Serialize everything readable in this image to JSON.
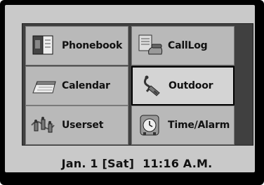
{
  "menu": {
    "items": [
      {
        "label": "Phonebook",
        "icon": "phonebook-icon",
        "selected": false
      },
      {
        "label": "CallLog",
        "icon": "call-log-icon",
        "selected": false
      },
      {
        "label": "Calendar",
        "icon": "calendar-icon",
        "selected": false
      },
      {
        "label": "Outdoor",
        "icon": "outdoor-icon",
        "selected": true
      },
      {
        "label": "Userset",
        "icon": "userset-icon",
        "selected": false
      },
      {
        "label": "Time/Alarm",
        "icon": "alarm-clock-icon",
        "selected": false
      }
    ]
  },
  "status": {
    "date": "Jan. 1 [Sat]",
    "time": "11:16 A.M."
  },
  "colors": {
    "screen_bg": "#c9c9c9",
    "item_bg": "#b9b9b9",
    "selected_bg": "#d4d4d4",
    "grid": "#404040"
  }
}
